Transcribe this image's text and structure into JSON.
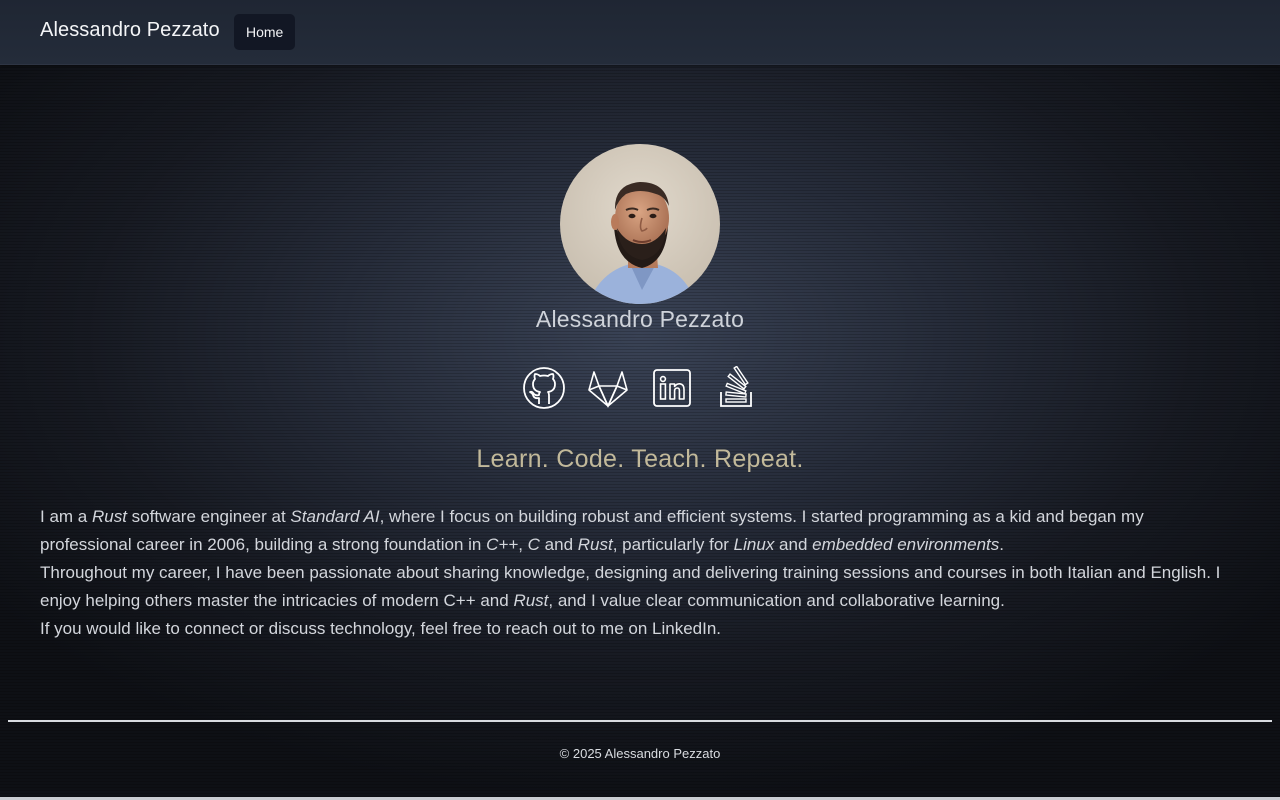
{
  "navbar": {
    "brand": "Alessandro Pezzato",
    "home_label": "Home"
  },
  "profile": {
    "name": "Alessandro Pezzato",
    "avatar_alt": "Alessandro Pezzato"
  },
  "socials": [
    {
      "icon": "github-icon",
      "label": "GitHub"
    },
    {
      "icon": "gitlab-icon",
      "label": "GitLab"
    },
    {
      "icon": "linkedin-icon",
      "label": "LinkedIn"
    },
    {
      "icon": "stackoverflow-icon",
      "label": "Stack Overflow"
    }
  ],
  "tagline": "Learn. Code. Teach. Repeat.",
  "bio": {
    "p1": {
      "t1": "I am a ",
      "e1": "Rust",
      "t2": " software engineer at ",
      "e2": "Standard AI",
      "t3": ", where I focus on building robust and efficient systems. I started programming as a kid and began my professional career in 2006, building a strong foundation in ",
      "e3": "C++",
      "t4": ", ",
      "e4": "C",
      "t5": " and ",
      "e5": "Rust",
      "t6": ", particularly for ",
      "e6": "Linux",
      "t7": " and ",
      "e7": "embedded environments",
      "t8": "."
    },
    "p2": {
      "t1": "Throughout my career, I have been passionate about sharing knowledge, designing and delivering training sessions and courses in both Italian and English. I enjoy helping others master the intricacies of modern C++ and ",
      "e1": "Rust",
      "t2": ", and I value clear communication and collaborative learning."
    },
    "p3": "If you would like to connect or discuss technology, feel free to reach out to me on LinkedIn."
  },
  "footer": {
    "copyright": "© 2025 Alessandro Pezzato"
  },
  "colors": {
    "accent_tagline": "#c2b99a",
    "nav_bg": "#222938",
    "home_button_bg": "#121724",
    "text": "#d3d6dc"
  }
}
